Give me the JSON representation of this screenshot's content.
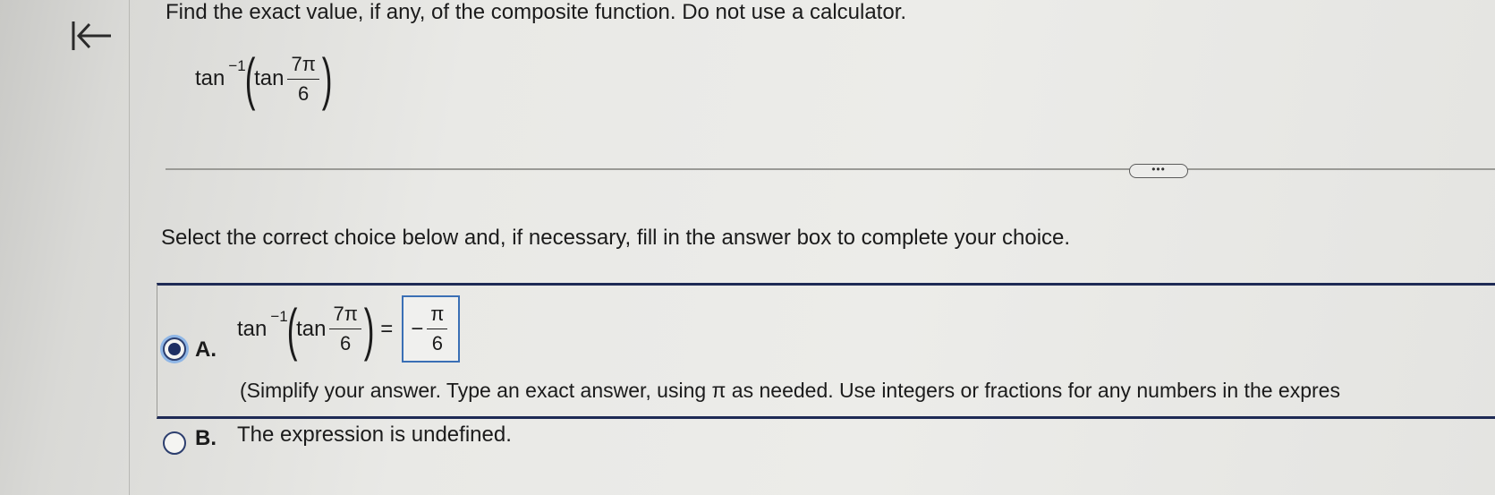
{
  "prompt": "Find the exact value, if any, of the composite function. Do not use a calculator.",
  "expression": {
    "func": "tan",
    "sup": "−1",
    "inner_func": "tan",
    "numerator": "7π",
    "denominator": "6"
  },
  "more_button": "•••",
  "instruction": "Select the correct choice below and, if necessary, fill in the answer box to complete your choice.",
  "choices": [
    {
      "letter": "A.",
      "selected": true,
      "expr": {
        "func": "tan",
        "sup": "−1",
        "inner_func": "tan",
        "numerator": "7π",
        "denominator": "6",
        "equals": "="
      },
      "answer": {
        "sign": "−",
        "numerator": "π",
        "denominator": "6"
      },
      "hint": "(Simplify your answer. Type an exact answer, using π as needed. Use integers or fractions for any numbers in the expres"
    },
    {
      "letter": "B.",
      "selected": false,
      "text": "The expression is undefined."
    }
  ],
  "icons": {
    "back": "collapse-left-icon"
  }
}
